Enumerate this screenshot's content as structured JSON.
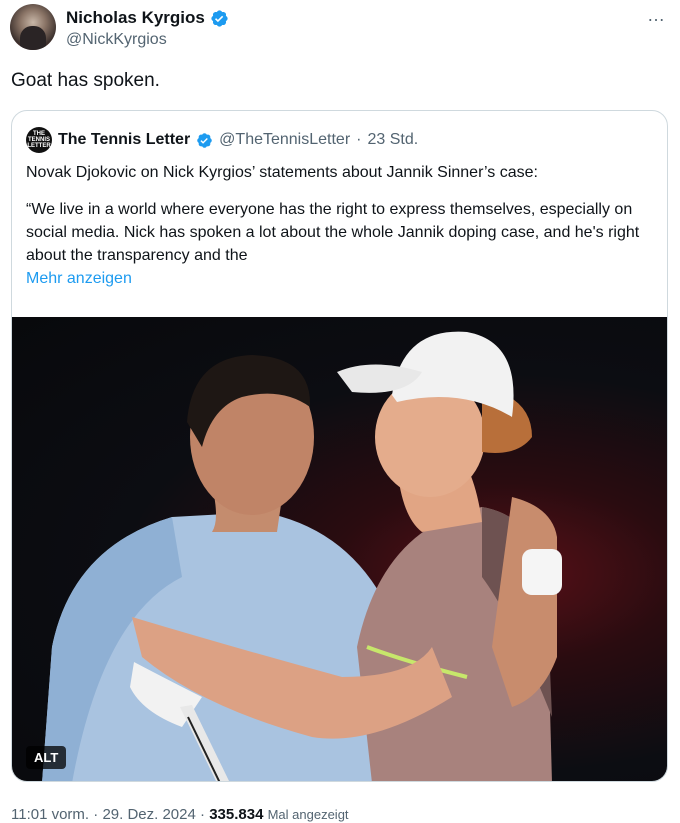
{
  "tweet": {
    "author_name": "Nicholas Kyrgios",
    "author_handle": "@NickKyrgios",
    "more_icon": "…",
    "text": "Goat has spoken."
  },
  "quote": {
    "avatar_text": "THE TENNIS LETTER",
    "author_name": "The Tennis Letter",
    "author_handle": "@TheTennisLetter",
    "separator": "·",
    "time_ago": "23 Std.",
    "paragraph1": "Novak Djokovic on Nick Kyrgios’ statements about Jannik Sinner’s case:",
    "paragraph2": "“We live in a world where everyone has the right to express themselves, especially on social media. Nick has spoken a lot about the whole Jannik doping case, and he's right about the transparency and the",
    "show_more": "Mehr anzeigen",
    "alt_badge": "ALT"
  },
  "meta": {
    "time": "11:01 vorm.",
    "separator": "·",
    "date": "29. Dez. 2024",
    "views": "335.834",
    "views_label": "Mal angezeigt"
  },
  "colors": {
    "verified": "#1d9bf0",
    "link": "#1d9bf0",
    "muted": "#536471"
  }
}
